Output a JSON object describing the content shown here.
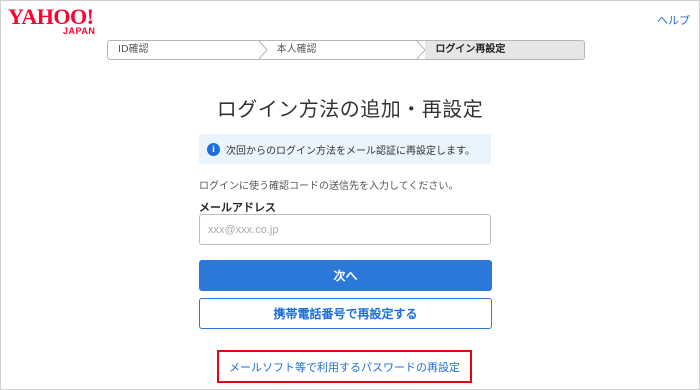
{
  "header": {
    "logo_main": "YAHOO!",
    "logo_sub": "JAPAN",
    "help_link": "ヘルプ"
  },
  "steps": [
    {
      "label": "ID確認",
      "active": false
    },
    {
      "label": "本人確認",
      "active": false
    },
    {
      "label": "ログイン再設定",
      "active": true
    }
  ],
  "main": {
    "title": "ログイン方法の追加・再設定",
    "info_icon": "info-icon",
    "info_text": "次回からのログイン方法をメール認証に再設定します。",
    "description": "ログインに使う確認コードの送信先を入力してください。",
    "email_label": "メールアドレス",
    "email_placeholder": "xxx@xxx.co.jp",
    "email_value": "",
    "next_button": "次へ",
    "phone_reset_button": "携帯電話番号で再設定する",
    "mail_software_link": "メールソフト等で利用するパスワードの再設定"
  },
  "colors": {
    "brand": "#ff0033",
    "accent": "#2b78d9",
    "link": "#1e6ed8",
    "highlight": "#e60012",
    "info_bg": "#e9f4fc"
  }
}
